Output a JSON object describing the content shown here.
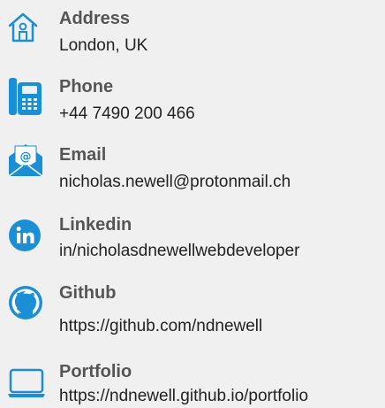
{
  "contacts": [
    {
      "icon": "house-icon",
      "title": "Address",
      "value": "London, UK"
    },
    {
      "icon": "phone-icon",
      "title": "Phone",
      "value": "+44  7490 200 466"
    },
    {
      "icon": "email-icon",
      "title": "Email",
      "value": "nicholas.newell@protonmail.ch"
    },
    {
      "icon": "linkedin-icon",
      "title": "Linkedin",
      "value": "in/nicholasdnewellwebdeveloper"
    },
    {
      "icon": "github-icon",
      "title": "Github",
      "value": "https://github.com/ndnewell"
    },
    {
      "icon": "laptop-icon",
      "title": "Portfolio",
      "value": "https://ndnewell.github.io/portfolio"
    }
  ],
  "colors": {
    "accent": "#1a8fd6",
    "title": "#555555",
    "text": "#222222",
    "background": "#f0f0f0"
  }
}
